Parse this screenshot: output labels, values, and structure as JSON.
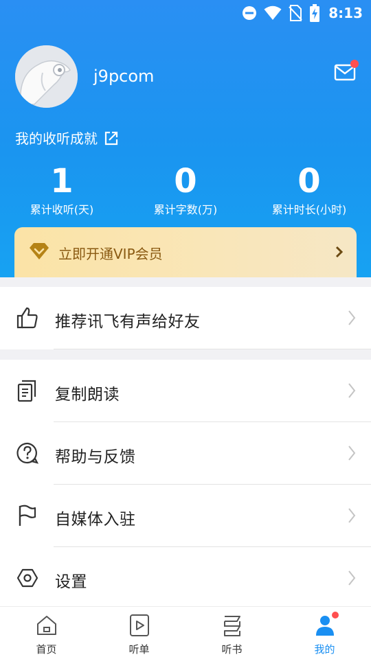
{
  "status_bar": {
    "time": "8:13"
  },
  "profile": {
    "username": "j9pcom"
  },
  "achievement": {
    "title": "我的收听成就"
  },
  "stats": [
    {
      "value": "1",
      "label": "累计收听(天)"
    },
    {
      "value": "0",
      "label": "累计字数(万)"
    },
    {
      "value": "0",
      "label": "累计时长(小时)"
    }
  ],
  "vip": {
    "label": "立即开通VIP会员"
  },
  "menu_top": {
    "recommend": "推荐讯飞有声给好友"
  },
  "menu": {
    "copy_read": "复制朗读",
    "help": "帮助与反馈",
    "media": "自媒体入驻",
    "settings": "设置"
  },
  "tabs": {
    "home": "首页",
    "playlist": "听单",
    "books": "听书",
    "mine": "我的"
  },
  "colors": {
    "primary": "#1a8ff2",
    "vip_text": "#8a5a12",
    "badge": "#ff4f4f"
  }
}
